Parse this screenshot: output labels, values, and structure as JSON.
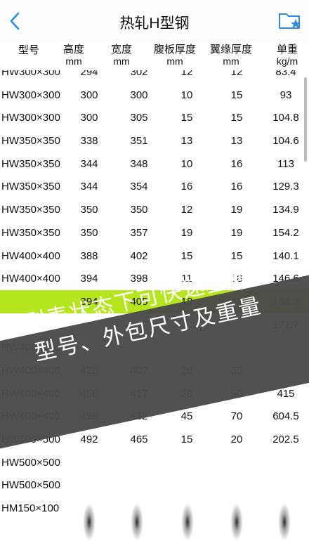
{
  "nav": {
    "title": "热轧H型钢",
    "back_icon": "chevron-left-icon",
    "folder_icon": "folder-star-icon",
    "accent": "#2a8be8"
  },
  "columns": [
    {
      "label": "型号",
      "unit": ""
    },
    {
      "label": "高度",
      "unit": "mm"
    },
    {
      "label": "宽度",
      "unit": "mm"
    },
    {
      "label": "腹板厚度",
      "unit": "mm"
    },
    {
      "label": "翼缘厚度",
      "unit": "mm"
    },
    {
      "label": "单重",
      "unit": "kg/m"
    }
  ],
  "rows": [
    [
      "HW300×300",
      "294",
      "302",
      "12",
      "12",
      "83.4"
    ],
    [
      "HW300×300",
      "300",
      "300",
      "10",
      "15",
      "93"
    ],
    [
      "HW300×300",
      "300",
      "305",
      "15",
      "15",
      "104.8"
    ],
    [
      "HW350×350",
      "338",
      "351",
      "13",
      "13",
      "104.6"
    ],
    [
      "HW350×350",
      "344",
      "348",
      "10",
      "16",
      "113"
    ],
    [
      "HW350×350",
      "344",
      "354",
      "16",
      "16",
      "129.3"
    ],
    [
      "HW350×350",
      "350",
      "350",
      "12",
      "19",
      "134.9"
    ],
    [
      "HW350×350",
      "350",
      "357",
      "19",
      "19",
      "154.2"
    ],
    [
      "HW400×400",
      "388",
      "402",
      "15",
      "15",
      "140.1"
    ],
    [
      "HW400×400",
      "394",
      "398",
      "11",
      "18",
      "146.6"
    ],
    [
      "",
      "394",
      "405",
      "18",
      "18",
      "168.3"
    ],
    [
      "",
      "",
      "",
      "",
      "",
      "171.7"
    ],
    [
      "HW400×400",
      "",
      "",
      "",
      "",
      ""
    ],
    [
      "HW400×400",
      "428",
      "407",
      "20",
      "35",
      ""
    ],
    [
      "HW400×400",
      "458",
      "417",
      "30",
      "50",
      "415"
    ],
    [
      "HW400×400",
      "498",
      "432",
      "45",
      "70",
      "604.5"
    ],
    [
      "HW500×500",
      "492",
      "465",
      "15",
      "20",
      "202.5"
    ],
    [
      "HW500×500",
      "",
      "",
      "",
      "",
      ""
    ],
    [
      "HW500×500",
      "",
      "",
      "",
      "",
      ""
    ],
    [
      "HM150×100",
      "",
      "",
      "",
      "",
      ""
    ]
  ],
  "highlight_row": 10,
  "highlight_color": "#b5e61d",
  "banner": {
    "line1": "列表状态下可快速查看——",
    "line2": "型号、外包尺寸及重量",
    "background": "#4a4a4a"
  }
}
